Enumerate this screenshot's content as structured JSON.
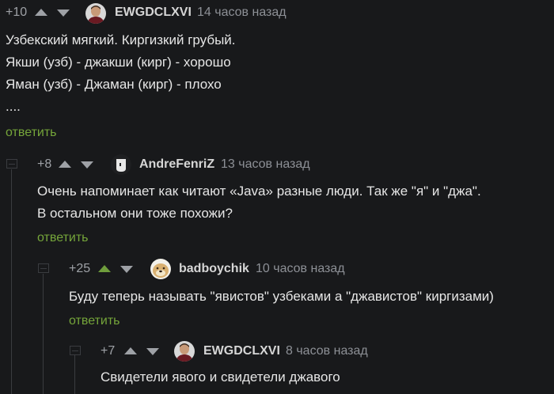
{
  "comments": [
    {
      "score": "+10",
      "username": "EWGDCLXVI",
      "time": "14 часов назад",
      "lines": [
        "Узбекский мягкий. Киргизкий грубый.",
        "Якши (узб) - джакши (кирг) - хорошо",
        "Яман (узб) - Джаман (кирг) - плохо",
        "...."
      ],
      "reply": "ответить",
      "avatar": "man-portrait-avatar"
    },
    {
      "score": "+8",
      "username": "AndreFenriZ",
      "time": "13 часов назад",
      "lines": [
        "Очень напоминает как читают «Java» разные люди. Так же \"я\" и \"джа\".",
        "В остальном они тоже похожи?"
      ],
      "reply": "ответить",
      "avatar": "cup-avatar"
    },
    {
      "score": "+25",
      "username": "badboychik",
      "time": "10 часов назад",
      "lines": [
        "Буду теперь называть \"явистов\" узбеками а \"джавистов\" киргизами)"
      ],
      "reply": "ответить",
      "avatar": "doge-avatar"
    },
    {
      "score": "+7",
      "username": "EWGDCLXVI",
      "time": "8 часов назад",
      "lines": [
        "Свидетели явого и свидетели джавого"
      ],
      "avatar": "man-portrait-avatar"
    }
  ],
  "colors": {
    "background": "#18191b",
    "upvote_active": "#6f9d3c",
    "reply_link": "#75a53a"
  }
}
